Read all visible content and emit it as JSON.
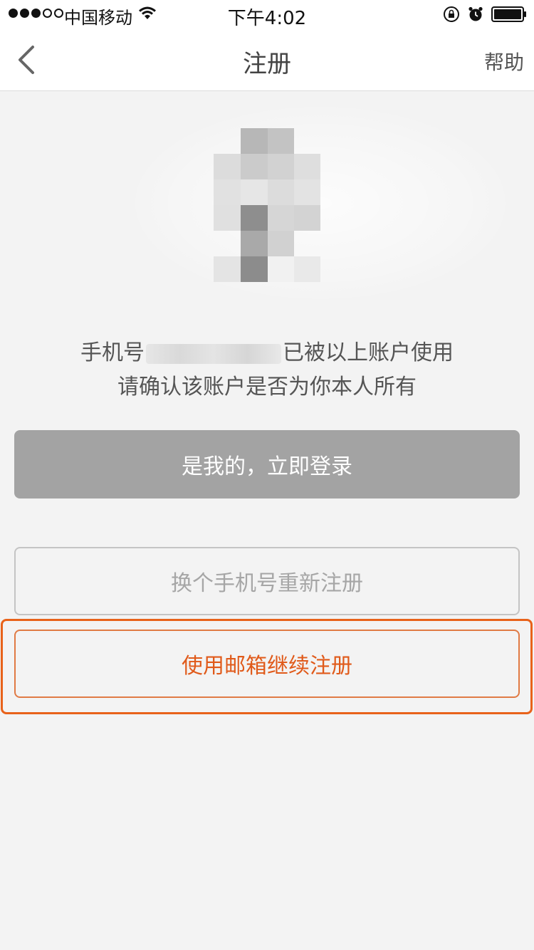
{
  "status_bar": {
    "carrier": "中国移动",
    "time": "下午4:02",
    "signal_bars_filled": 3,
    "signal_bars_total": 5
  },
  "nav": {
    "title": "注册",
    "help_label": "帮助"
  },
  "info": {
    "line1_prefix": "手机号",
    "line1_suffix": "已被以上账户使用",
    "line2": "请确认该账户是否为你本人所有"
  },
  "buttons": {
    "login_label": "是我的，立即登录",
    "change_phone_label": "换个手机号重新注册",
    "email_label": "使用邮箱继续注册"
  },
  "colors": {
    "accent": "#e05a1a",
    "primary_button": "#a3a3a3",
    "background": "#f3f3f3"
  },
  "icons": [
    "chevron-left-icon",
    "wifi-icon",
    "rotation-lock-icon",
    "alarm-icon",
    "battery-icon"
  ]
}
